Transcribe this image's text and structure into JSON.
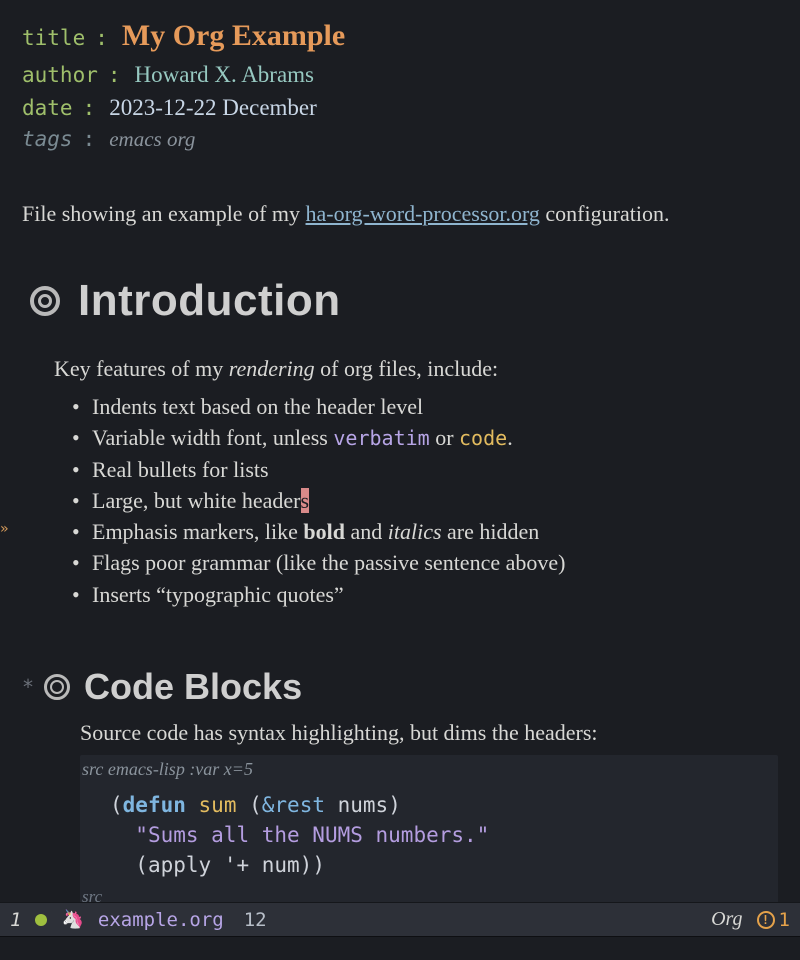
{
  "meta": {
    "title_key": "title",
    "title_val": "My Org Example",
    "author_key": "author",
    "author_val": "Howard X. Abrams",
    "date_key": "date",
    "date_val": "2023-12-22 December",
    "tags_key": "tags",
    "tags_val": "emacs org"
  },
  "intro": {
    "pre": "File showing an example of my ",
    "link": "ha-org-word-processor.org",
    "post": " configuration."
  },
  "sections": {
    "introduction": {
      "heading": "Introduction",
      "lead_pre": "Key features of my ",
      "lead_em": "rendering",
      "lead_post": " of org files, include:",
      "bullets": [
        {
          "text": "Indents text based on the header level"
        },
        {
          "pre": "Variable width font, unless ",
          "verbatim": "verbatim",
          "mid": " or ",
          "code": "code",
          "post": "."
        },
        {
          "text": "Real bullets for lists"
        },
        {
          "pre": "Large, but white header",
          "cursor": "s"
        },
        {
          "pre": "Emphasis markers, like ",
          "bold": "bold",
          "mid": " and ",
          "italic": "italics",
          "post": " are hidden"
        },
        {
          "text": "Flags poor grammar (like the passive sentence above)"
        },
        {
          "text": "Inserts “typographic quotes”"
        }
      ]
    },
    "code_blocks": {
      "star": "*",
      "heading": "Code Blocks",
      "lead": "Source code has syntax highlighting, but dims the headers:",
      "src_header": "src emacs-lisp :var x=5",
      "code": {
        "l1_open": "(",
        "l1_defun": "defun",
        "l1_sp1": " ",
        "l1_name": "sum",
        "l1_sp2": " (",
        "l1_amp": "&rest",
        "l1_sp3": " nums)",
        "l2_indent": "  ",
        "l2_str": "\"Sums all the NUMS numbers.\"",
        "l3_indent": "  ",
        "l3_open": "(apply ",
        "l3_q": "'",
        "l3_rest": "+ num))"
      },
      "src_footer": "src"
    }
  },
  "modeline": {
    "win_num": "1",
    "file": "example.org",
    "col": "12",
    "mode": "Org",
    "warn": "1"
  },
  "icons": {
    "heading_bullet": "circle-outline-double-icon",
    "fringe_arrow": "»",
    "unicorn": "🦄"
  }
}
